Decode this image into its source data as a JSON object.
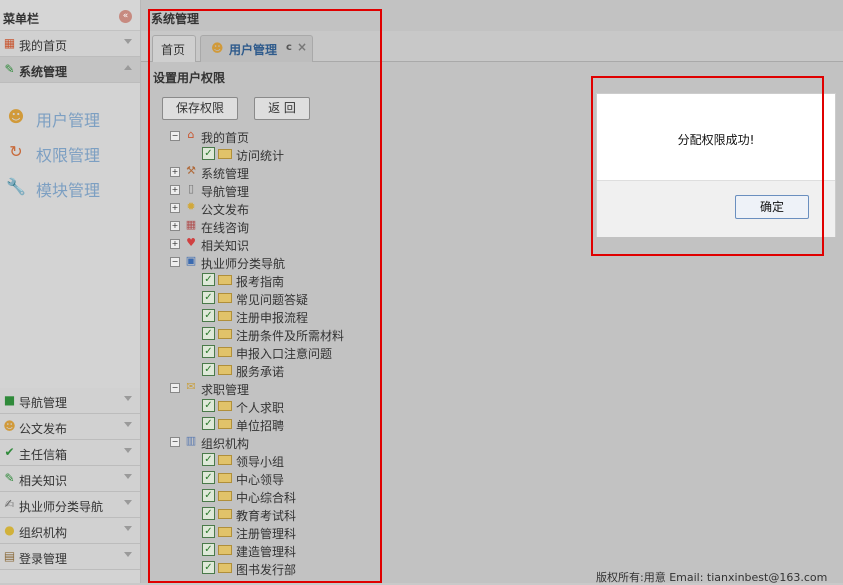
{
  "sidebar": {
    "title": "菜单栏",
    "collapse_icon": "collapse-icon",
    "top_items": [
      {
        "label": "我的首页",
        "icon": "grid-icon"
      },
      {
        "label": "系统管理",
        "icon": "pencil-icon"
      }
    ],
    "nav_links": [
      {
        "label": "用户管理",
        "icon": "users-icon"
      },
      {
        "label": "权限管理",
        "icon": "refresh-icon"
      },
      {
        "label": "模块管理",
        "icon": "wrench-icon"
      }
    ],
    "bottom_items": [
      {
        "label": "导航管理",
        "icon": "map-icon"
      },
      {
        "label": "公文发布",
        "icon": "users-icon"
      },
      {
        "label": "主任信箱",
        "icon": "check-icon"
      },
      {
        "label": "相关知识",
        "icon": "pencil-icon"
      },
      {
        "label": "执业师分类导航",
        "icon": "edit-icon"
      },
      {
        "label": "组织机构",
        "icon": "bulb-icon"
      },
      {
        "label": "登录管理",
        "icon": "login-icon"
      }
    ]
  },
  "main": {
    "breadcrumb": "系统管理",
    "tabs": [
      {
        "label": "首页"
      },
      {
        "label": "用户管理",
        "refresh": "c",
        "close": "×"
      }
    ],
    "section_title": "设置用户权限",
    "buttons": {
      "save": "保存权限",
      "back": "返 回"
    },
    "tree": {
      "groups": [
        {
          "label": "我的首页",
          "expanded": true,
          "icon": "home-icon",
          "children": [
            "访问统计"
          ]
        },
        {
          "label": "系统管理",
          "expanded": false,
          "icon": "tools-icon",
          "children": []
        },
        {
          "label": "导航管理",
          "expanded": false,
          "icon": "page-icon",
          "children": []
        },
        {
          "label": "公文发布",
          "expanded": false,
          "icon": "gear-icon",
          "children": []
        },
        {
          "label": "在线咨询",
          "expanded": false,
          "icon": "calendar-icon",
          "children": []
        },
        {
          "label": "相关知识",
          "expanded": false,
          "icon": "heart-icon",
          "children": []
        },
        {
          "label": "执业师分类导航",
          "expanded": true,
          "icon": "disk-icon",
          "children": [
            "报考指南",
            "常见问题答疑",
            "注册申报流程",
            "注册条件及所需材料",
            "申报入口注意问题",
            "服务承诺"
          ]
        },
        {
          "label": "求职管理",
          "expanded": true,
          "icon": "envelope-icon",
          "children": [
            "个人求职",
            "单位招聘"
          ]
        },
        {
          "label": "组织机构",
          "expanded": true,
          "icon": "chart-icon",
          "children": [
            "领导小组",
            "中心领导",
            "中心综合科",
            "教育考试科",
            "注册管理科",
            "建造管理科",
            "图书发行部"
          ]
        }
      ]
    },
    "footer": "版权所有:用意 Email: tianxinbest@163.com"
  },
  "modal": {
    "message": "分配权限成功!",
    "ok_label": "确定"
  },
  "colors": {
    "highlight_border": "#e00000",
    "nav_link": "#7c9fc2",
    "checkbox": "#2c7a2c"
  }
}
